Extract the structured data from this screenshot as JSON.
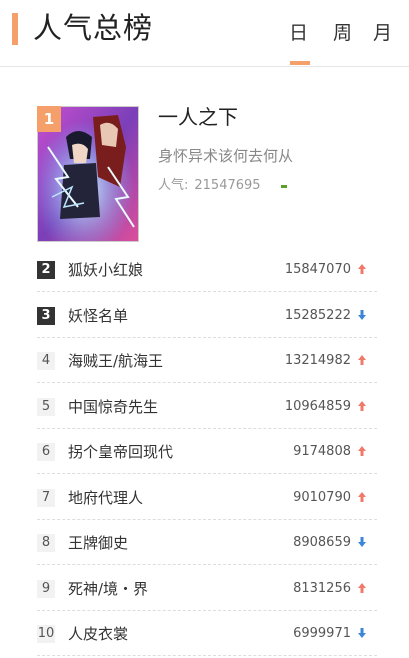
{
  "header": {
    "title": "人气总榜",
    "tabs": [
      "日",
      "周",
      "月"
    ],
    "active_tab": "日",
    "accent_color": "#f5a06a"
  },
  "top1": {
    "rank": "1",
    "title": "一人之下",
    "desc": "身怀异术该何去何从",
    "pop_label": "人气:",
    "pop_value": "21547695",
    "trend": "flat"
  },
  "list": [
    {
      "rank": "2",
      "name": "狐妖小红娘",
      "score": "15847070",
      "trend": "up"
    },
    {
      "rank": "3",
      "name": "妖怪名单",
      "score": "15285222",
      "trend": "down"
    },
    {
      "rank": "4",
      "name": "海贼王/航海王",
      "score": "13214982",
      "trend": "up"
    },
    {
      "rank": "5",
      "name": "中国惊奇先生",
      "score": "10964859",
      "trend": "up"
    },
    {
      "rank": "6",
      "name": "拐个皇帝回现代",
      "score": "9174808",
      "trend": "up"
    },
    {
      "rank": "7",
      "name": "地府代理人",
      "score": "9010790",
      "trend": "up"
    },
    {
      "rank": "8",
      "name": "王牌御史",
      "score": "8908659",
      "trend": "down"
    },
    {
      "rank": "9",
      "name": "死神/境・界",
      "score": "8131256",
      "trend": "up"
    },
    {
      "rank": "10",
      "name": "人皮衣裳",
      "score": "6999971",
      "trend": "down"
    }
  ]
}
